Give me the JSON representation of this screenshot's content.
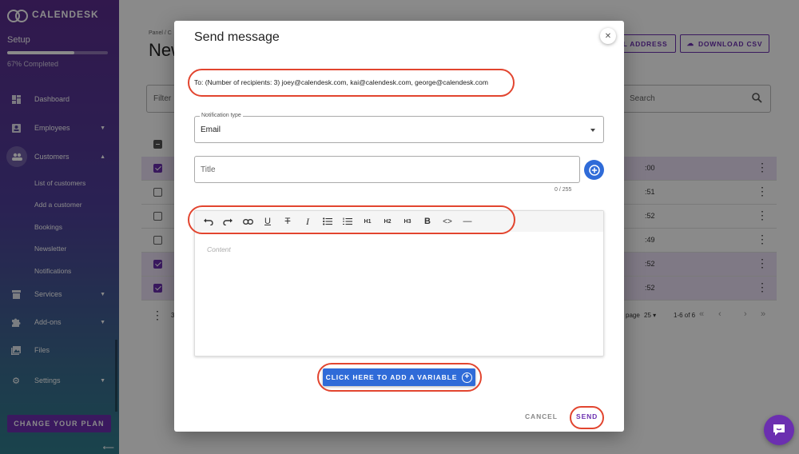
{
  "app": {
    "brand": "CALENDESK"
  },
  "sidebar": {
    "setup_label": "Setup",
    "progress_pct": 67,
    "progress_text": "67% Completed",
    "items": [
      {
        "label": "Dashboard",
        "icon": "dashboard-icon"
      },
      {
        "label": "Employees",
        "icon": "badge-icon"
      },
      {
        "label": "Customers",
        "icon": "people-icon"
      },
      {
        "label": "Services",
        "icon": "store-icon"
      },
      {
        "label": "Add-ons",
        "icon": "puzzle-icon"
      },
      {
        "label": "Files",
        "icon": "image-icon"
      },
      {
        "label": "Settings",
        "icon": "gear-icon"
      }
    ],
    "customer_subitems": [
      "List of customers",
      "Add a customer",
      "Bookings",
      "Newsletter",
      "Notifications"
    ],
    "change_plan_label": "CHANGE YOUR PLAN",
    "collapse_glyph": "⟵"
  },
  "page": {
    "breadcrumb": "Panel / C",
    "title": "New",
    "email_button_label": "L ADDRESS",
    "download_csv_label": "DOWNLOAD CSV",
    "filter_placeholder": "Filter",
    "search_placeholder": "Search",
    "rows": [
      {
        "time": ":00",
        "selected": true
      },
      {
        "time": ":51",
        "selected": false
      },
      {
        "time": ":52",
        "selected": false
      },
      {
        "time": ":49",
        "selected": false
      },
      {
        "time": ":52",
        "selected": true
      },
      {
        "time": ":52",
        "selected": true
      }
    ],
    "footer_count": "3",
    "rows_per_page_label": "page",
    "rows_per_page_value": "25",
    "range_text": "1-6 of 6"
  },
  "modal": {
    "title": "Send message",
    "recipients_text": "To: (Number of recipients: 3) joey@calendesk.com, kai@calendesk.com, george@calendesk.com",
    "notification_type_label": "Notification type",
    "notification_type_value": "Email",
    "title_placeholder": "Title",
    "title_counter": "0 / 255",
    "toolbar": {
      "h1": "H1",
      "h2": "H2",
      "h3": "H3"
    },
    "content_placeholder": "Content",
    "variable_button_label": "CLICK HERE TO ADD A VARIABLE",
    "cancel_label": "CANCEL",
    "send_label": "SEND"
  },
  "colors": {
    "brand_purple": "#6b2fb0",
    "accent_blue": "#2f6bd8",
    "highlight_red": "#e2452f"
  }
}
